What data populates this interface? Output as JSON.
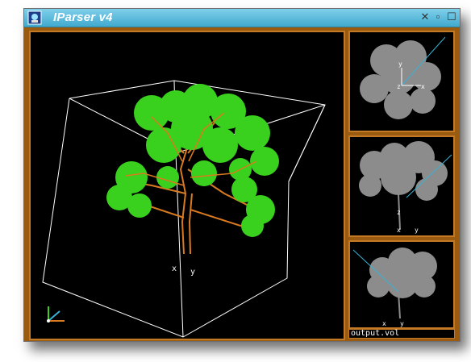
{
  "window": {
    "title": "IParser v4",
    "buttons": {
      "close": "✕",
      "minimize": "▫",
      "maximize": "☐"
    }
  },
  "viewports": {
    "main": {
      "axis_x": "x",
      "axis_y": "y"
    },
    "top": {
      "axis_x": "x",
      "axis_y": "y",
      "axis_z": "z"
    },
    "front": {
      "axis_x": "x",
      "axis_y": "y",
      "axis_z": "z"
    },
    "side": {
      "axis_x": "x",
      "axis_y": "y"
    }
  },
  "status": {
    "filename": "output.vol"
  },
  "colors": {
    "titlebar": "#41a9cf",
    "frame": "#9a5a10",
    "leaves_main": "#3ad11e",
    "trunk": "#d97a1f",
    "leaves_ortho": "#8c8c8c",
    "guide_line": "#36b3d6"
  }
}
